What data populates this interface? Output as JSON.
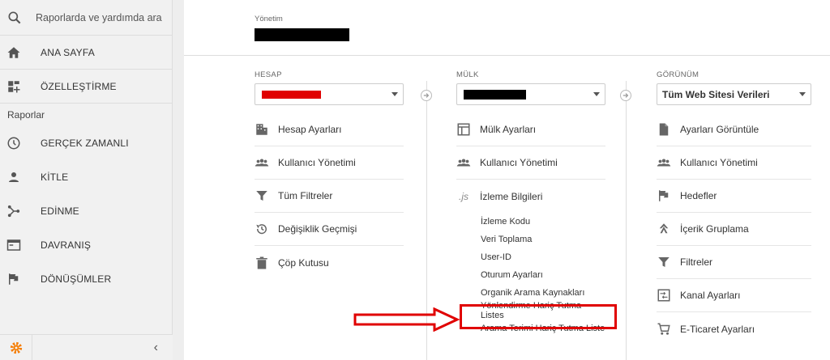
{
  "sidebar": {
    "search_placeholder": "Raporlarda ve yardımda ara",
    "items": [
      {
        "label": "ANA SAYFA",
        "icon": "home-icon"
      },
      {
        "label": "ÖZELLEŞTİRME",
        "icon": "customization-icon"
      }
    ],
    "section_label": "Raporlar",
    "report_items": [
      {
        "label": "GERÇEK ZAMANLI",
        "icon": "clock-icon"
      },
      {
        "label": "KİTLE",
        "icon": "person-icon"
      },
      {
        "label": "EDİNME",
        "icon": "acquisition-icon"
      },
      {
        "label": "DAVRANIŞ",
        "icon": "behavior-icon"
      },
      {
        "label": "DÖNÜŞÜMLER",
        "icon": "flag-icon"
      }
    ],
    "collapse_glyph": "‹"
  },
  "header": {
    "label": "Yönetim"
  },
  "account": {
    "heading": "HESAP",
    "items": [
      {
        "label": "Hesap Ayarları",
        "icon": "building-icon"
      },
      {
        "label": "Kullanıcı Yönetimi",
        "icon": "users-icon"
      },
      {
        "label": "Tüm Filtreler",
        "icon": "filter-icon"
      },
      {
        "label": "Değişiklik Geçmişi",
        "icon": "history-icon"
      },
      {
        "label": "Çöp Kutusu",
        "icon": "trash-icon"
      }
    ]
  },
  "property": {
    "heading": "MÜLK",
    "items": [
      {
        "label": "Mülk Ayarları",
        "icon": "window-icon"
      },
      {
        "label": "Kullanıcı Yönetimi",
        "icon": "users-icon"
      },
      {
        "label": "İzleme Bilgileri",
        "icon": "js-icon"
      }
    ],
    "js_glyph": ".js",
    "subitems": [
      "İzleme Kodu",
      "Veri Toplama",
      "User-ID",
      "Oturum Ayarları",
      "Organik Arama Kaynakları",
      "Yönlendirme Hariç Tutma Listes",
      "Arama Terimi Hariç Tutma Liste"
    ]
  },
  "view": {
    "heading": "GÖRÜNÜM",
    "selected": "Tüm Web Sitesi Verileri",
    "items": [
      {
        "label": "Ayarları Görüntüle",
        "icon": "document-icon"
      },
      {
        "label": "Kullanıcı Yönetimi",
        "icon": "users-icon"
      },
      {
        "label": "Hedefler",
        "icon": "flag-icon"
      },
      {
        "label": "İçerik Gruplama",
        "icon": "content-grouping-icon"
      },
      {
        "label": "Filtreler",
        "icon": "filter-icon"
      },
      {
        "label": "Kanal Ayarları",
        "icon": "channel-icon"
      },
      {
        "label": "E-Ticaret Ayarları",
        "icon": "cart-icon"
      }
    ]
  },
  "colors": {
    "highlight": "#e00000",
    "accent": "#f57c00"
  }
}
